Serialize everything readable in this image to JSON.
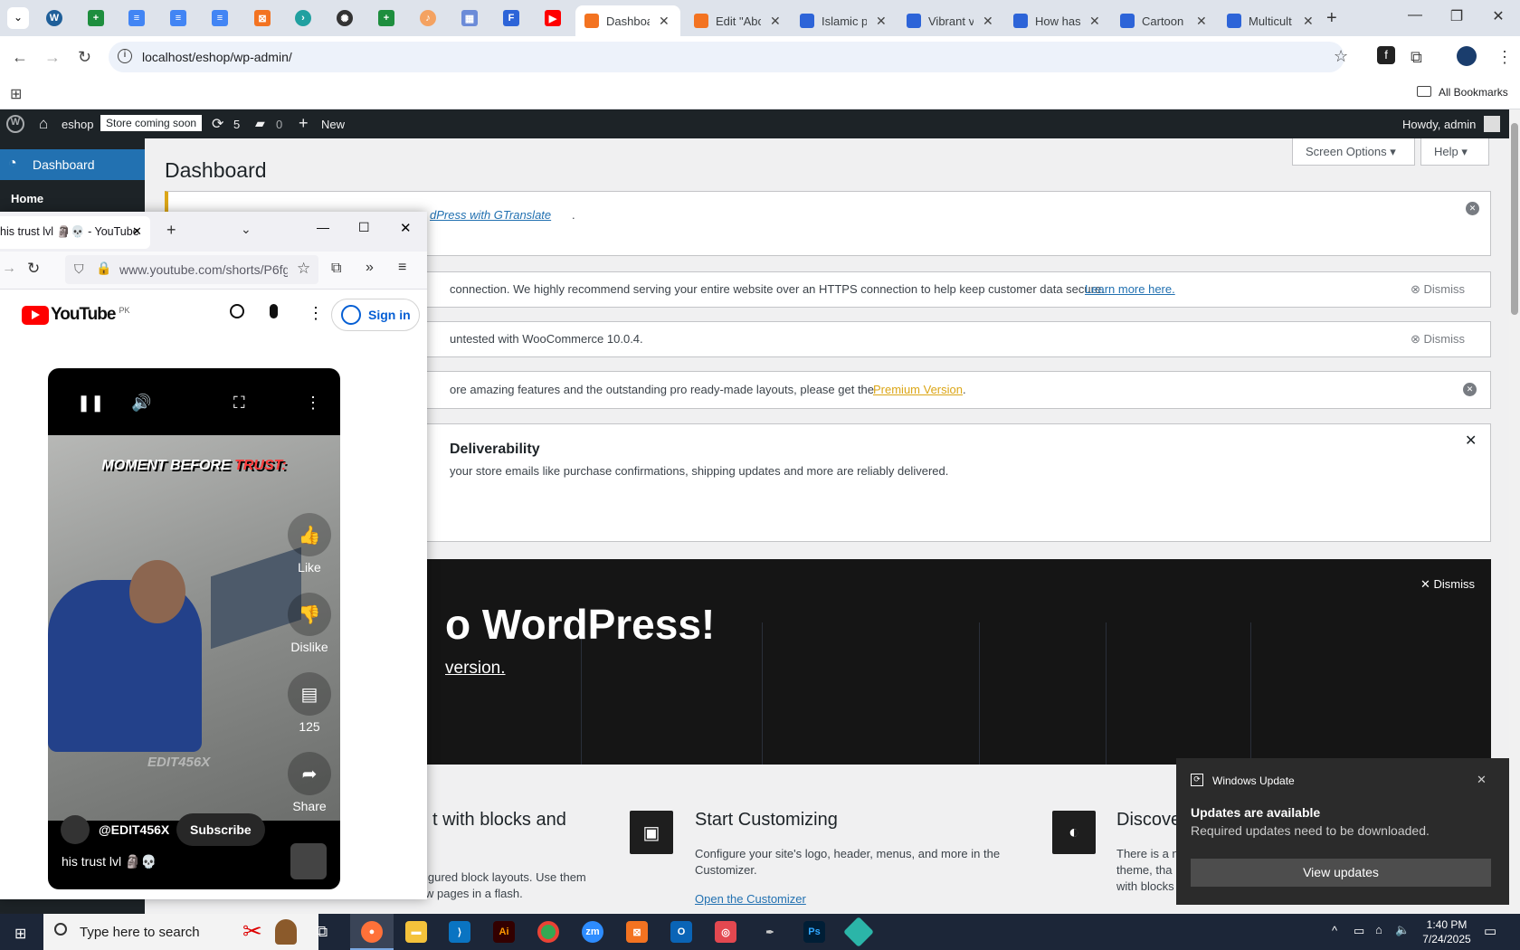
{
  "browser": {
    "tabs": [
      {
        "title": "Dashboard",
        "active": true
      },
      {
        "title": "Edit \"About"
      },
      {
        "title": "Islamic p"
      },
      {
        "title": "Vibrant v"
      },
      {
        "title": "How has"
      },
      {
        "title": "Cartoon"
      },
      {
        "title": "Multicult"
      }
    ],
    "url": "localhost/eshop/wp-admin/",
    "bookmarks_label": "All Bookmarks"
  },
  "wp": {
    "site_name": "eshop",
    "store_badge": "Store coming soon",
    "updates_count": "5",
    "comments_count": "0",
    "new_label": "New",
    "howdy": "Howdy, admin",
    "sidebar": {
      "dashboard": "Dashboard",
      "home": "Home"
    },
    "page_title": "Dashboard",
    "screen_options": "Screen Options",
    "help": "Help",
    "notices": {
      "gtranslate_link": "dPress with GTranslate",
      "gtranslate_tail": ".",
      "https_text": "connection. We highly recommend serving your entire website over an HTTPS connection to help keep customer data secure.",
      "https_link": "Learn more here.",
      "woo_text": "untested with WooCommerce 10.0.4.",
      "premium_text": "ore amazing features and the outstanding pro ready-made layouts, please get the",
      "premium_link": "Premium Version",
      "premium_tail": ".",
      "deliverability_title": "Deliverability",
      "deliverability_text": "your store emails like purchase confirmations, shipping updates and more are reliably delivered.",
      "dismiss": "Dismiss"
    },
    "welcome": {
      "heading": "o WordPress!",
      "version_link": "version.",
      "dismiss": "Dismiss"
    },
    "columns": [
      {
        "title": "t with blocks and",
        "text": "igured block layouts. Use them\nw pages in a flash."
      },
      {
        "title": "Start Customizing",
        "text": "Configure your site's logo, header, menus, and more in the Customizer.",
        "link": "Open the Customizer"
      },
      {
        "title": "Discove",
        "text": "There is a n\ntheme, tha\nwith blocks"
      }
    ]
  },
  "firefox": {
    "tab_title": "his trust lvl 🗿💀 - YouTube",
    "url": "www.youtube.com/shorts/P6fg",
    "youtube": {
      "logo_text": "YouTube",
      "region": "PK",
      "sign_in": "Sign in",
      "caption_white": "MOMENT BEFORE ",
      "caption_red": "TRUST:",
      "watermark": "EDIT456X",
      "like": "Like",
      "dislike": "Dislike",
      "comments": "125",
      "share": "Share",
      "channel": "@EDIT456X",
      "subscribe": "Subscribe",
      "title": "his trust lvl 🗿💀"
    }
  },
  "toast": {
    "app": "Windows Update",
    "title": "Updates are available",
    "body": "Required updates need to be downloaded.",
    "button": "View updates"
  },
  "taskbar": {
    "search_placeholder": "Type here to search",
    "time": "1:40 PM",
    "date": "7/24/2025"
  }
}
